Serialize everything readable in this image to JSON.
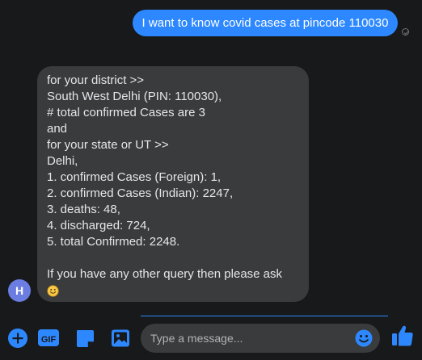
{
  "outgoing": {
    "text": "I want to know covid cases at pincode 110030"
  },
  "incoming": {
    "lines": [
      "for your district >>",
      "South West Delhi (PIN: 110030),",
      "# total confirmed Cases are 3",
      "and",
      "for your state or UT >>",
      "Delhi,",
      "1. confirmed Cases (Foreign): 1,",
      "2. confirmed Cases (Indian): 2247,",
      "3. deaths: 48,",
      "4. discharged: 724,",
      "5. total Confirmed: 2248.",
      "",
      "If you have any other query then please ask"
    ],
    "emoji": "smiley-emoji"
  },
  "avatar": {
    "initial": "H"
  },
  "composer": {
    "placeholder": "Type a message...",
    "icons": [
      "plus-icon",
      "gif-icon",
      "sticker-icon",
      "image-icon",
      "emoji-icon",
      "thumbs-up-icon"
    ]
  },
  "colors": {
    "background": "#18191a",
    "accent": "#2d88ff",
    "bubble_in": "#3a3b3c",
    "text_in": "#e4e6eb",
    "avatar": "#6b7de0"
  }
}
